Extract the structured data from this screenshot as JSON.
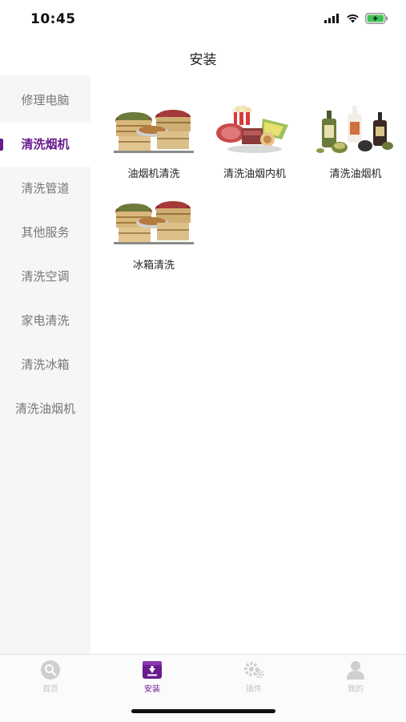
{
  "status_bar": {
    "time": "10:45"
  },
  "header": {
    "title": "安装"
  },
  "sidebar": {
    "items": [
      {
        "label": "修理电脑",
        "active": false
      },
      {
        "label": "清洗烟机",
        "active": true
      },
      {
        "label": "清洗管道",
        "active": false
      },
      {
        "label": "其他服务",
        "active": false
      },
      {
        "label": "清洗空调",
        "active": false
      },
      {
        "label": "家电清洗",
        "active": false
      },
      {
        "label": "清洗冰箱",
        "active": false
      },
      {
        "label": "清洗油烟机",
        "active": false
      }
    ]
  },
  "grid": {
    "items": [
      {
        "label": "油烟机清洗",
        "image": "grain-baskets-image"
      },
      {
        "label": "清洗油烟内机",
        "image": "food-platter-image"
      },
      {
        "label": "清洗油烟机",
        "image": "bottles-image"
      },
      {
        "label": "冰箱清洗",
        "image": "grain-baskets-image"
      }
    ]
  },
  "tabbar": {
    "tabs": [
      {
        "label": "首页",
        "icon": "search-icon",
        "active": false
      },
      {
        "label": "安装",
        "icon": "download-box-icon",
        "active": true
      },
      {
        "label": "插件",
        "icon": "gears-icon",
        "active": false
      },
      {
        "label": "我的",
        "icon": "user-icon",
        "active": false
      }
    ]
  },
  "colors": {
    "accent": "#6a1b8e",
    "sidebar_bg": "#f6f6f6",
    "inactive_text": "#777777"
  }
}
